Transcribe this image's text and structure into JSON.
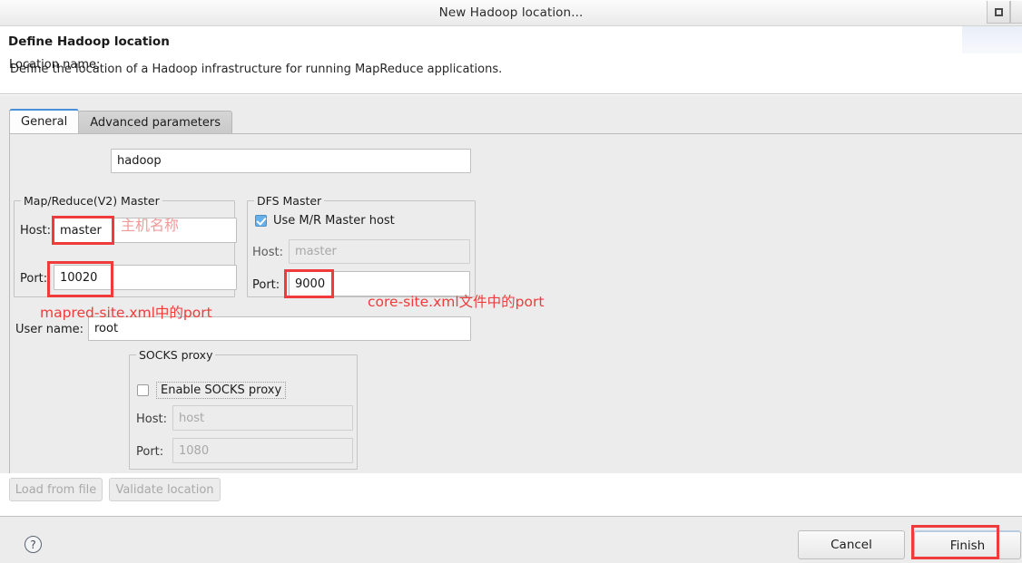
{
  "window": {
    "title": "New Hadoop location...",
    "restore_button_icon": "restore-window-icon"
  },
  "header": {
    "title": "Define Hadoop location",
    "description": "Define the location of a Hadoop infrastructure for running MapReduce applications."
  },
  "tabs": [
    {
      "id": "general",
      "label": "General",
      "active": true
    },
    {
      "id": "advanced",
      "label": "Advanced parameters",
      "active": false
    }
  ],
  "form": {
    "location_name": {
      "label": "Location name:",
      "value": "hadoop",
      "placeholder": ""
    },
    "mapreduce_master": {
      "group_title": "Map/Reduce(V2) Master",
      "host": {
        "label": "Host:",
        "value": "master"
      },
      "port": {
        "label": "Port:",
        "value": "10020"
      }
    },
    "dfs_master": {
      "group_title": "DFS Master",
      "use_mr_master_host": {
        "label": "Use M/R Master host",
        "checked": true
      },
      "host": {
        "label": "Host:",
        "value": "",
        "placeholder": "master",
        "disabled": true
      },
      "port": {
        "label": "Port:",
        "value": "9000"
      }
    },
    "user_name": {
      "label": "User name:",
      "value": "root"
    },
    "socks_proxy": {
      "group_title": "SOCKS proxy",
      "enable": {
        "label": "Enable SOCKS proxy",
        "checked": false
      },
      "host": {
        "label": "Host:",
        "value": "",
        "placeholder": "host",
        "disabled": true
      },
      "port": {
        "label": "Port:",
        "value": "",
        "placeholder": "1080",
        "disabled": true
      }
    }
  },
  "actions": {
    "load_from_file": {
      "label": "Load from file",
      "enabled": false
    },
    "validate_location": {
      "label": "Validate location",
      "enabled": false
    },
    "help": {
      "icon": "help-question-icon",
      "label": "?"
    },
    "cancel": {
      "label": "Cancel"
    },
    "finish": {
      "label": "Finish"
    }
  },
  "annotations": {
    "hostname": "主机名称",
    "mapred_port": "mapred-site.xml中的port",
    "core_port": "core-site.xml文件中的port",
    "highlight_color": "#ef3b3b",
    "faded_color": "#f09a9a"
  }
}
